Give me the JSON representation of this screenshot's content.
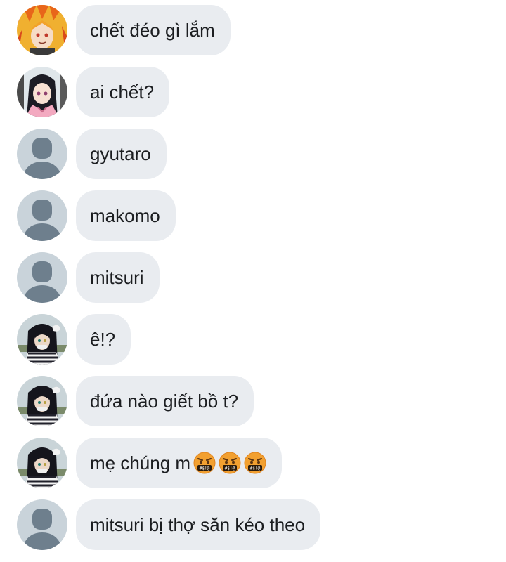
{
  "messages": [
    {
      "avatar": "character-fire-hair",
      "text": "chết đéo gì lắm"
    },
    {
      "avatar": "character-pink-kimono",
      "text": "ai chết?"
    },
    {
      "avatar": "default-user",
      "text": "gyutaro"
    },
    {
      "avatar": "default-user",
      "text": "makomo"
    },
    {
      "avatar": "default-user",
      "text": "mitsuri"
    },
    {
      "avatar": "character-dark-hair",
      "text": "ê!?"
    },
    {
      "avatar": "character-dark-hair",
      "text": "đứa nào giết bồ t?"
    },
    {
      "avatar": "character-dark-hair",
      "text": "mẹ chúng m",
      "emojis": [
        "face-with-symbols-on-mouth",
        "face-with-symbols-on-mouth",
        "face-with-symbols-on-mouth"
      ]
    },
    {
      "avatar": "default-user",
      "text": "mitsuri bị thợ săn kéo theo"
    }
  ],
  "colors": {
    "bubble": "#e9ecf0",
    "text": "#1c1e21",
    "default_avatar_bg": "#c9d3da",
    "default_avatar_fg": "#6e7f8d"
  }
}
